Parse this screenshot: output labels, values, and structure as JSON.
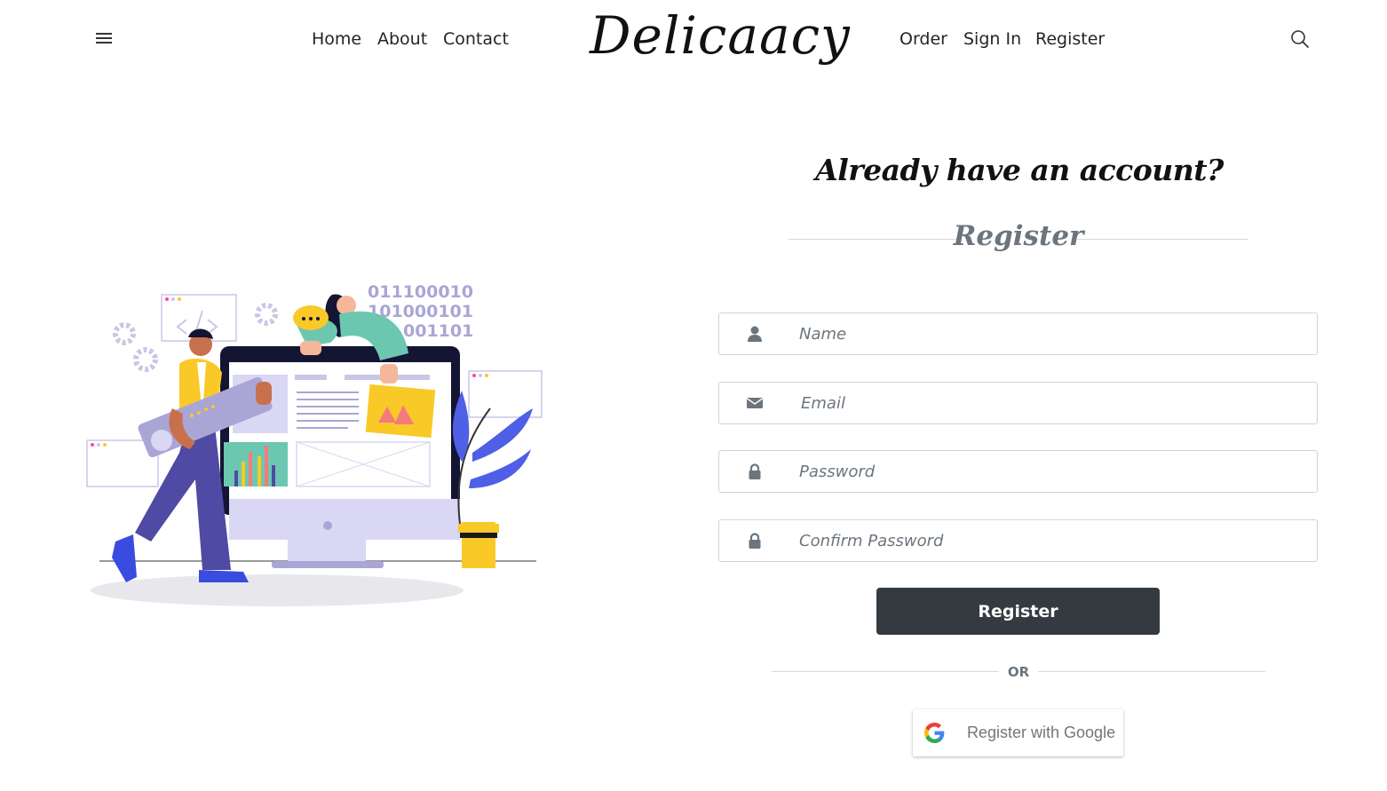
{
  "nav": {
    "left_links": [
      "Home",
      "About",
      "Contact"
    ],
    "brand": "Delicaacy",
    "right_links": [
      "Order",
      "Sign In",
      "Register"
    ]
  },
  "illustration": {
    "binary_lines": [
      "011100010",
      "101000101",
      "001101"
    ]
  },
  "form": {
    "heading": "Already have an account?",
    "subheading": "Register",
    "fields": [
      {
        "icon": "user-icon",
        "placeholder": "Name",
        "value": ""
      },
      {
        "icon": "envelope-icon",
        "placeholder": "Email",
        "value": ""
      },
      {
        "icon": "lock-icon",
        "placeholder": "Password",
        "value": ""
      },
      {
        "icon": "lock-icon",
        "placeholder": "Confirm Password",
        "value": ""
      }
    ],
    "submit_label": "Register",
    "divider_label": "OR",
    "google_label": "Register with Google"
  },
  "colors": {
    "button_dark": "#343a40",
    "muted": "#6c757d",
    "accent_purple": "#4f4aa3",
    "accent_yellow": "#f9c927",
    "accent_teal": "#6cc7b0"
  }
}
